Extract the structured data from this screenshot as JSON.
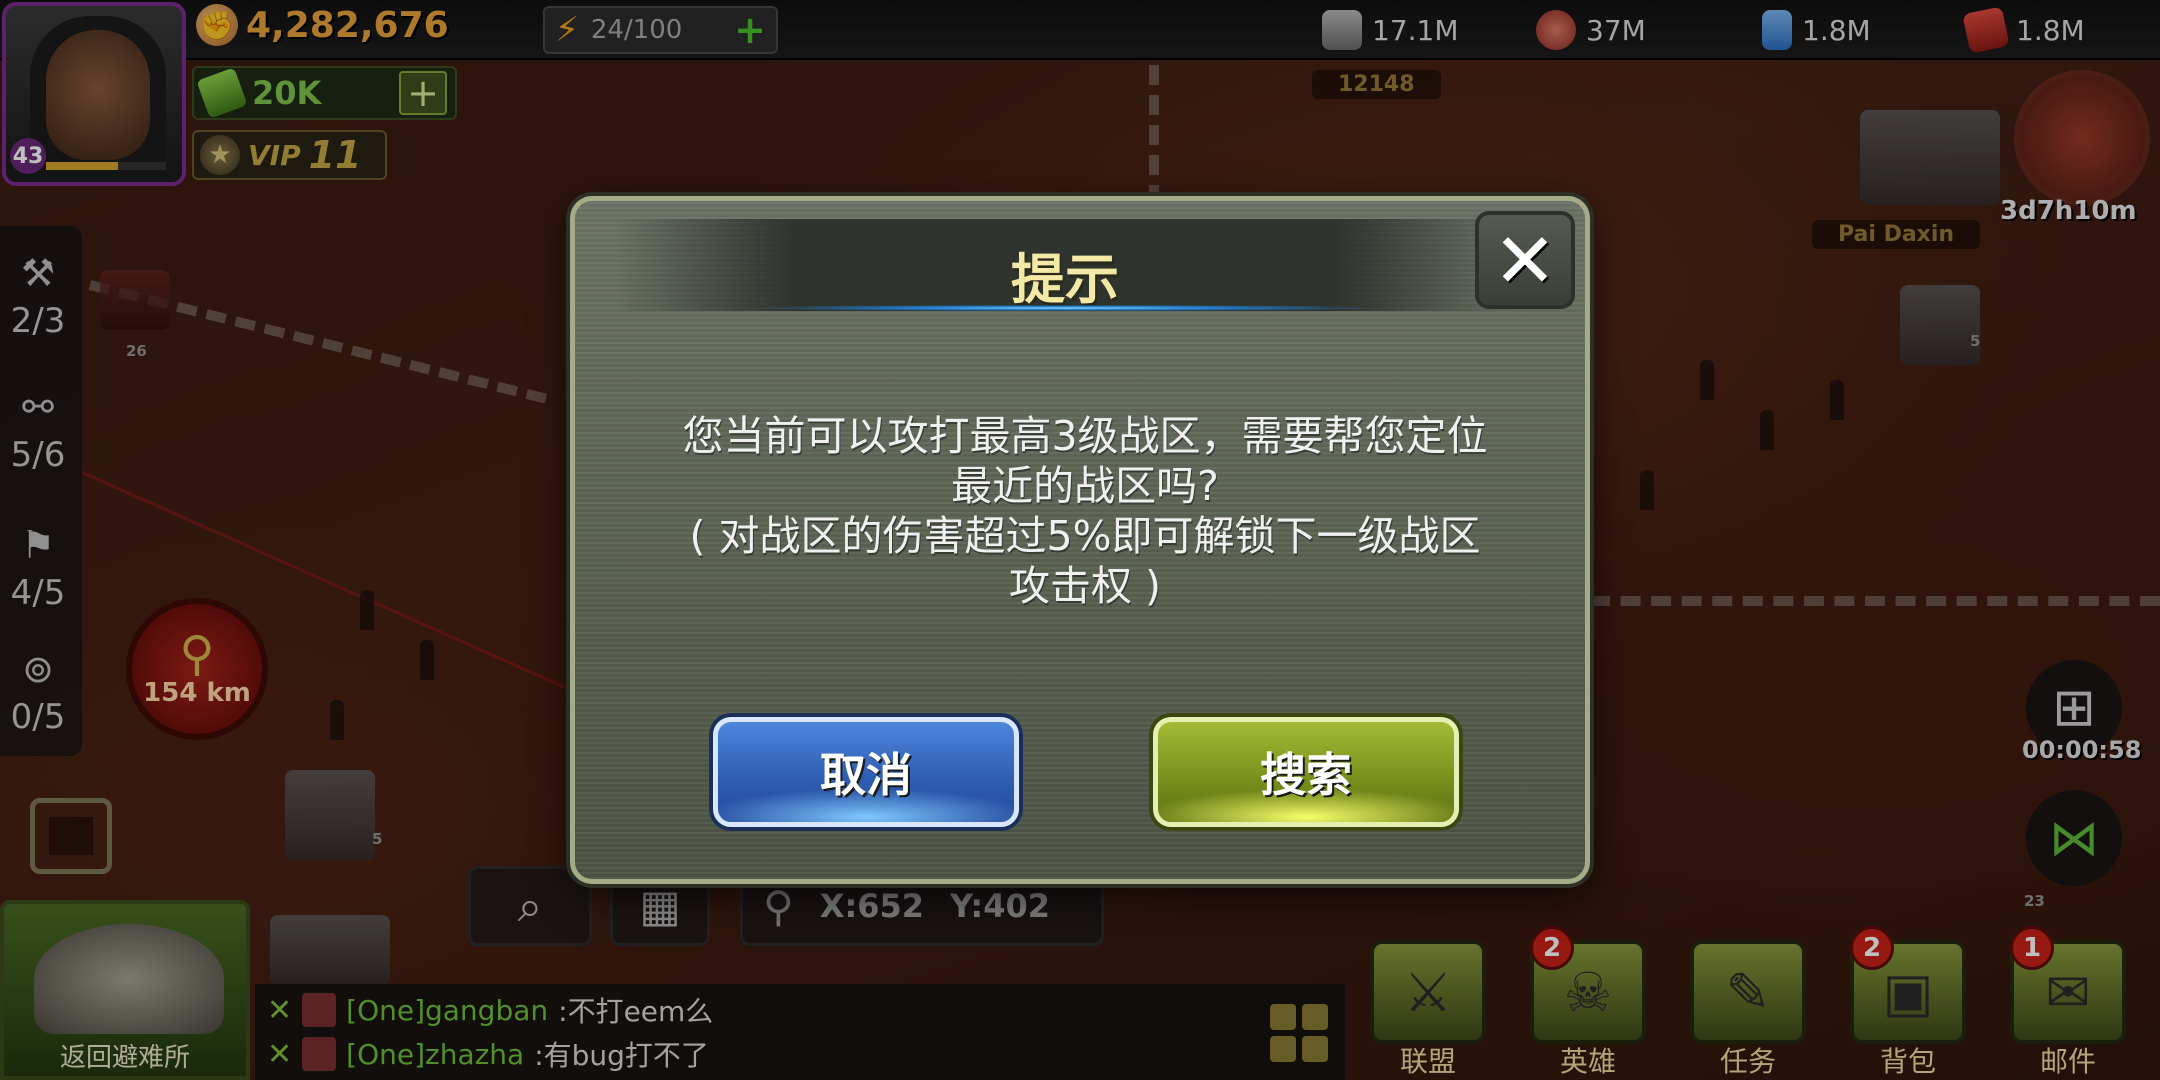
{
  "top_bar": {
    "power": "4,282,676",
    "energy": "24/100",
    "resources": [
      {
        "icon": "oil-barrel-icon",
        "value": "17.1M",
        "color": "#9c9c9c"
      },
      {
        "icon": "food-can-icon",
        "value": "37M",
        "color": "#c04a3a"
      },
      {
        "icon": "water-bottle-icon",
        "value": "1.8M",
        "color": "#3a7fd0"
      },
      {
        "icon": "fuel-can-icon",
        "value": "1.8M",
        "color": "#c2302a"
      }
    ]
  },
  "player": {
    "level": "43",
    "cash": "20K",
    "vip_label": "VIP",
    "vip_level": "11"
  },
  "map": {
    "labels": {
      "top_score": "12148",
      "base_name": "Pai Daxin",
      "event_timer": "3d7h10m",
      "small_lvl_a": "26",
      "small_lvl_b": "5",
      "small_lvl_c": "5",
      "small_lvl_d": "23"
    },
    "distance": "154 km"
  },
  "side_panel": {
    "items": [
      {
        "icon": "hammer-icon",
        "count": "2/3"
      },
      {
        "icon": "dumbbell-icon",
        "count": "5/6"
      },
      {
        "icon": "flag-icon",
        "count": "4/5"
      },
      {
        "icon": "binoculars-icon",
        "count": "0/5"
      }
    ]
  },
  "coords": {
    "x": "X:652",
    "y": "Y:402"
  },
  "shelter_label": "返回避难所",
  "chat": [
    {
      "name": "[One]gangban",
      "message": ":不打eem么"
    },
    {
      "name": "[One]zhazha",
      "message": ":有bug打不了"
    }
  ],
  "right": {
    "gift_timer": "00:00:58"
  },
  "nav": [
    {
      "label": "联盟",
      "icon": "pistols-icon",
      "badge": ""
    },
    {
      "label": "英雄",
      "icon": "gas-mask-icon",
      "badge": "2"
    },
    {
      "label": "任务",
      "icon": "clipboard-icon",
      "badge": ""
    },
    {
      "label": "背包",
      "icon": "backpack-icon",
      "badge": "2"
    },
    {
      "label": "邮件",
      "icon": "envelope-icon",
      "badge": "1"
    }
  ],
  "dialog": {
    "title": "提示",
    "line1": "您当前可以攻打最高3级战区，需要帮您定位",
    "line2": "最近的战区吗?",
    "line3": "( 对战区的伤害超过5%即可解锁下一级战区",
    "line4": "攻击权 )",
    "cancel_label": "取消",
    "search_label": "搜索",
    "close_glyph": "✕"
  }
}
